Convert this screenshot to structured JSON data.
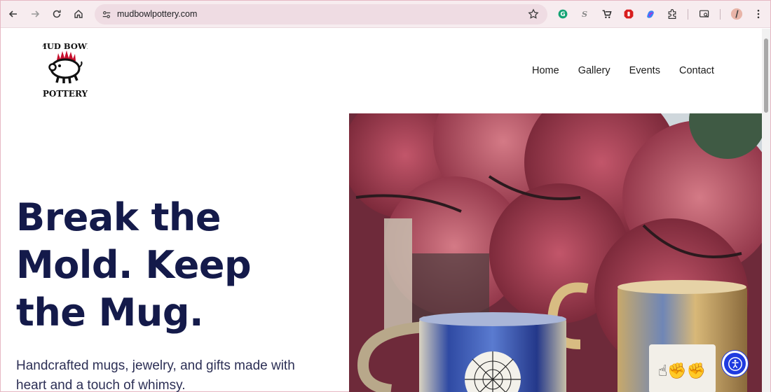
{
  "browser": {
    "url": "mudbowlpottery.com",
    "accent": "#f7ecef",
    "omnibox_color": "#efdce3"
  },
  "site": {
    "logo_text_top": "MUD BOWL",
    "logo_text_bottom": "POTTERY",
    "nav": [
      {
        "label": "Home"
      },
      {
        "label": "Gallery"
      },
      {
        "label": "Events"
      },
      {
        "label": "Contact"
      }
    ]
  },
  "hero": {
    "title": "Break the Mold. Keep the Mug.",
    "subtitle": "Handcrafted mugs, jewelry, and gifts made with heart and a touch of whimsy.",
    "title_color": "#141a4a"
  },
  "icons": {
    "back": "arrow-left-icon",
    "forward": "arrow-right-icon",
    "reload": "reload-icon",
    "home": "home-icon",
    "star": "star-icon",
    "accessibility": "accessibility-icon"
  }
}
